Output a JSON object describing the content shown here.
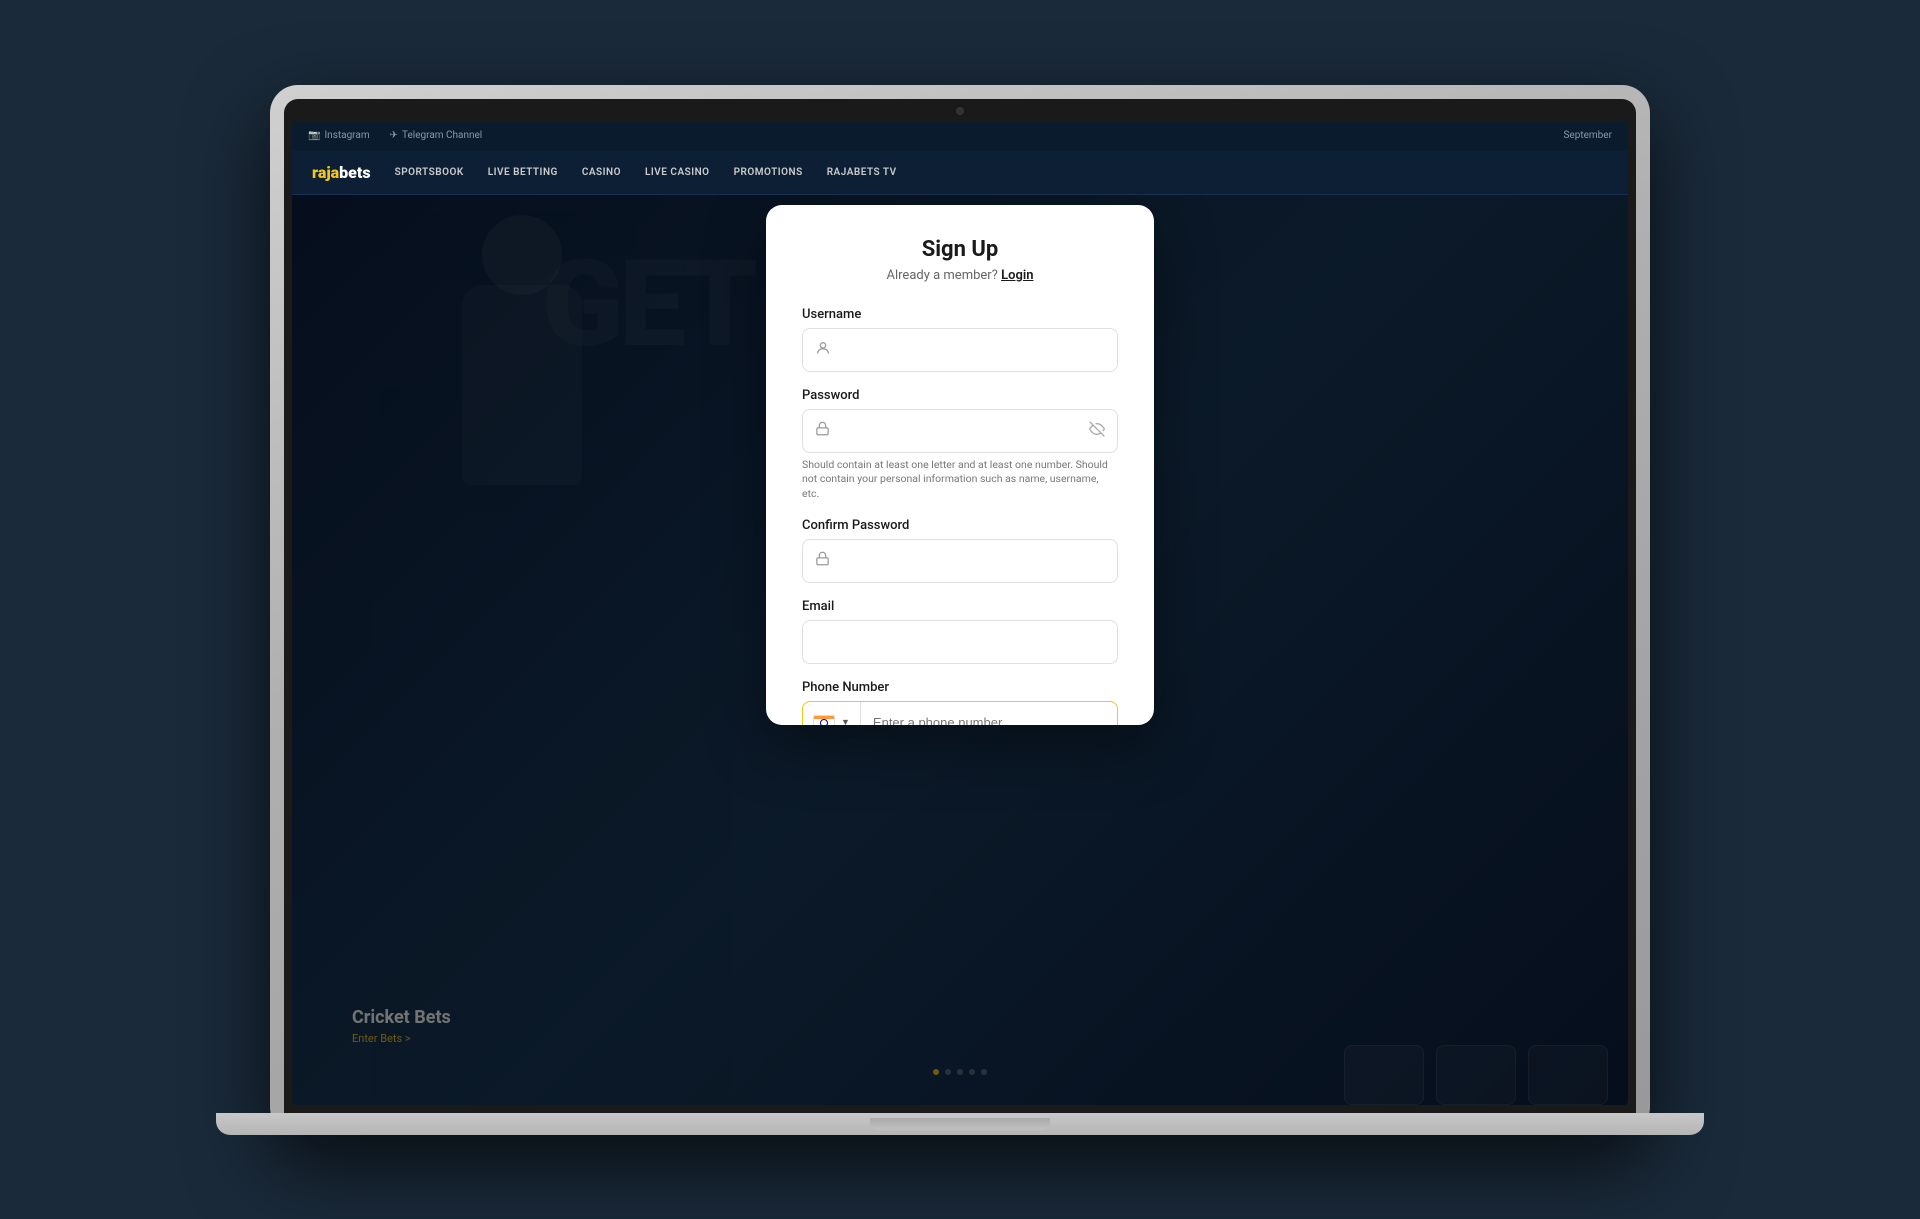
{
  "laptop": {
    "camera_label": "camera"
  },
  "site": {
    "topbar": {
      "instagram_label": "Instagram",
      "telegram_label": "Telegram Channel",
      "date_label": "September"
    },
    "nav": {
      "logo_part1": "raja",
      "logo_part2": "bets",
      "items": [
        {
          "label": "SPORTSBOOK"
        },
        {
          "label": "LIVE BETTING"
        },
        {
          "label": "CASINO"
        },
        {
          "label": "LIVE CASINO"
        },
        {
          "label": "PROMOTIONS"
        },
        {
          "label": "RAJABETS TV"
        }
      ]
    },
    "hero": {
      "big_text": "GET",
      "title": "Cricket Bets",
      "subtitle": "Enter Bets >"
    },
    "dots": [
      {
        "active": true
      },
      {
        "active": false
      },
      {
        "active": false
      },
      {
        "active": false
      },
      {
        "active": false
      }
    ]
  },
  "modal": {
    "close_label": "×",
    "title": "Sign Up",
    "subtitle_text": "Already a member?",
    "login_label": "Login",
    "fields": {
      "username": {
        "label": "Username",
        "placeholder": ""
      },
      "password": {
        "label": "Password",
        "placeholder": "",
        "hint": "Should contain at least one letter and at least one number. Should not contain your personal information such as name, username, etc."
      },
      "confirm_password": {
        "label": "Confirm Password",
        "placeholder": ""
      },
      "email": {
        "label": "Email",
        "placeholder": ""
      },
      "phone": {
        "label": "Phone Number",
        "placeholder": "Enter a phone number",
        "country_flag": "IN"
      }
    }
  }
}
